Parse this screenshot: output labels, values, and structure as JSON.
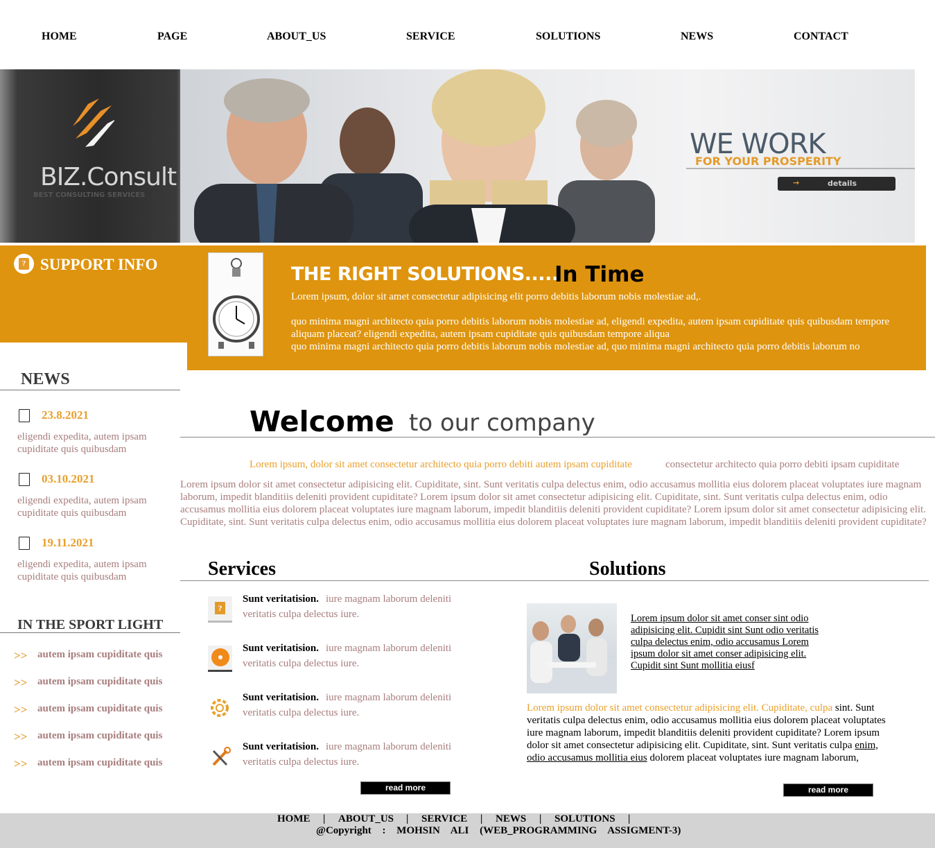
{
  "nav": {
    "items": [
      "HOME",
      "PAGE",
      "ABOUT_US",
      "SERVICE",
      "SOLUTIONS",
      "NEWS",
      "CONTACT"
    ]
  },
  "banner": {
    "logo_name": "BIZ.Consult",
    "logo_tagline": "BEST CONSULTING SERVICES",
    "headline": "WE WORK",
    "subheadline": "FOR YOUR PROSPERITY",
    "details_button": "details"
  },
  "support": {
    "title": "SUPPORT INFO"
  },
  "right_solutions": {
    "title": "THE RIGHT SOLUTIONS.....",
    "title_emph": "In Time",
    "line1": "Lorem ipsum, dolor sit amet consectetur adipisicing elit porro debitis laborum nobis molestiae ad,.",
    "line2": "quo minima magni architecto quia porro debitis laborum nobis molestiae ad, eligendi expedita, autem ipsam cupiditate quis quibusdam tempore aliquam placeat? eligendi expedita, autem ipsam cupiditate quis quibusdam tempore aliqua",
    "line3": "quo minima magni architecto quia porro debitis laborum nobis molestiae ad, quo minima magni architecto quia porro debitis laborum no"
  },
  "news": {
    "heading": "NEWS",
    "items": [
      {
        "date": "23.8.2021",
        "text": "eligendi expedita, autem ipsam cupiditate quis quibusdam"
      },
      {
        "date": "03.10.2021",
        "text": "eligendi expedita, autem ipsam cupiditate quis quibusdam"
      },
      {
        "date": "19.11.2021",
        "text": "eligendi expedita, autem ipsam cupiditate quis quibusdam"
      }
    ]
  },
  "sport_light": {
    "heading": "IN THE SPORT LIGHT",
    "arrow": ">>",
    "items": [
      "autem ipsam cupiditate quis",
      "autem ipsam cupiditate quis",
      "autem ipsam cupiditate quis",
      "autem ipsam cupiditate quis",
      "autem ipsam cupiditate quis"
    ]
  },
  "welcome": {
    "title": "Welcome",
    "subtitle": "to our company",
    "lead_orange": "Lorem ipsum, dolor sit amet consectetur architecto quia porro debiti autem ipsam cupiditate",
    "lead_brown": "consectetur architecto quia porro debiti ipsam cupiditate",
    "paragraph": "Lorem ipsum dolor sit amet consectetur adipisicing elit. Cupiditate, sint. Sunt veritatis culpa delectus enim, odio accusamus mollitia eius dolorem placeat voluptates iure magnam laborum, impedit blanditiis deleniti provident cupiditate? Lorem ipsum dolor sit amet consectetur adipisicing elit. Cupiditate, sint. Sunt veritatis culpa delectus enim, odio accusamus mollitia eius dolorem placeat voluptates iure magnam laborum, impedit blanditiis deleniti provident cupiditate? Lorem ipsum dolor sit amet consectetur adipisicing elit. Cupiditate, sint. Sunt veritatis culpa delectus enim, odio accusamus mollitia eius dolorem placeat voluptates iure magnam laborum, impedit blanditiis deleniti provident cupiditate?"
  },
  "services": {
    "heading": "Services",
    "items": [
      {
        "icon": "support-icon",
        "title": "Sunt veritatision.",
        "text": "iure magnam laborum deleniti veritatis culpa delectus iure."
      },
      {
        "icon": "disc-icon",
        "title": "Sunt veritatision.",
        "text": "iure magnam laborum deleniti veritatis culpa delectus iure."
      },
      {
        "icon": "gear-icon",
        "title": "Sunt veritatision.",
        "text": "iure magnam laborum deleniti veritatis culpa delectus iure."
      },
      {
        "icon": "tools-icon",
        "title": "Sunt veritatision.",
        "text": "iure magnam laborum deleniti veritatis culpa delectus iure."
      }
    ],
    "read_more": "read more"
  },
  "solutions": {
    "heading": "Solutions",
    "link_text": "Lorem ipsum dolor sit amet conser sint odio adipisicing elit. Cupidit sint Sunt odio veritatis culpa delectus enim, odio accusamus Lorem ipsum dolor sit amet conser adipisicing elit. Cupidit sint Sunt mollitia eiusf",
    "para_orange": "Lorem ipsum dolor sit amet consectetur adipisicing elit. Cupiditate, culpa",
    "para_black1": "sint. Sunt veritatis culpa delectus enim, odio accusamus mollitia eius dolorem placeat voluptates iure magnam laborum, impedit blanditiis deleniti provident cupiditate? Lorem ipsum dolor sit amet consectetur adipisicing elit. Cupiditate, sint. Sunt veritatis culpa",
    "para_link": "enim, odio accusamus mollitia eius",
    "para_black2": "dolorem placeat voluptates iure magnam laborum,",
    "read_more": "read more"
  },
  "footer": {
    "links": [
      "HOME",
      "ABOUT_US",
      "SERVICE",
      "NEWS",
      "SOLUTIONS"
    ],
    "separator": "|",
    "copyright": "@Copyright : MOHSIN ALI (WEB_PROGRAMMING ASSIGMENT-3)"
  },
  "colors": {
    "accent": "#de940e",
    "muted_text": "#a87d7d",
    "orange_text": "#e8a02c"
  }
}
